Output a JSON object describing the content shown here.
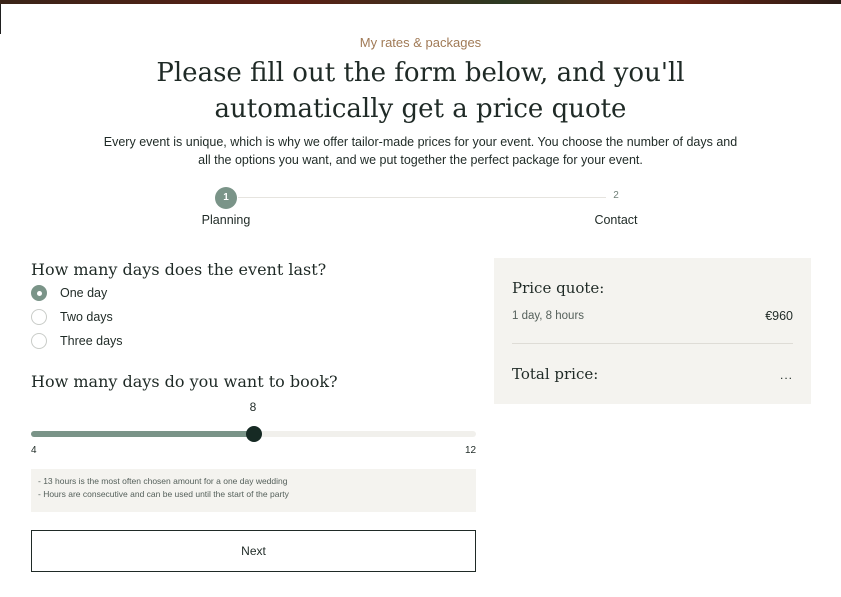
{
  "header": {
    "eyebrow": "My rates & packages",
    "title": "Please fill out the form below, and you'll automatically get a price quote",
    "intro": "Every event is unique, which is why we offer tailor-made prices for your event. You choose the number of days and all the options you want, and we put together the perfect package for your event."
  },
  "stepper": {
    "steps": [
      {
        "number": "1",
        "label": "Planning",
        "active": true
      },
      {
        "number": "2",
        "label": "Contact",
        "active": false
      }
    ]
  },
  "form": {
    "days_question": "How many days does the event last?",
    "day_options": [
      {
        "label": "One day",
        "selected": true
      },
      {
        "label": "Two days",
        "selected": false
      },
      {
        "label": "Three days",
        "selected": false
      }
    ],
    "book_question": "How many days do you want to book?",
    "slider": {
      "value": 8,
      "value_label": "8",
      "min": 4,
      "max": 12,
      "min_label": "4",
      "max_label": "12"
    },
    "notes": [
      "- 13 hours is the most often chosen amount for a one day wedding",
      "- Hours are consecutive and can be used until the start of the party"
    ],
    "next_label": "Next"
  },
  "quote": {
    "title": "Price quote:",
    "line_label": "1 day, 8 hours",
    "line_amount": "€960",
    "total_label": "Total price:",
    "total_value": "..."
  },
  "colors": {
    "accent": "#7a9488",
    "dark": "#162a24",
    "eyebrow": "#a07a56",
    "panel": "#f4f3ef"
  }
}
